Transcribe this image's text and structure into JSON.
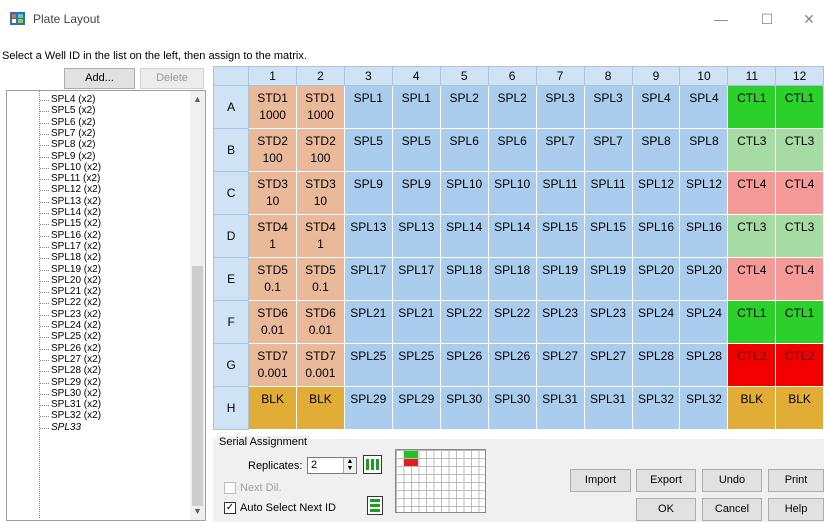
{
  "window": {
    "title": "Plate Layout",
    "minimize": "—",
    "maximize": "☐",
    "close": "✕"
  },
  "instruction": "Select a Well ID in the list on the left, then assign to the matrix.",
  "toolbar": {
    "add": "Add...",
    "delete": "Delete"
  },
  "list_items": [
    "SPL4 (x2)",
    "SPL5 (x2)",
    "SPL6 (x2)",
    "SPL7 (x2)",
    "SPL8 (x2)",
    "SPL9 (x2)",
    "SPL10 (x2)",
    "SPL11 (x2)",
    "SPL12 (x2)",
    "SPL13 (x2)",
    "SPL14 (x2)",
    "SPL15 (x2)",
    "SPL16 (x2)",
    "SPL17 (x2)",
    "SPL18 (x2)",
    "SPL19 (x2)",
    "SPL20 (x2)",
    "SPL21 (x2)",
    "SPL22 (x2)",
    "SPL23 (x2)",
    "SPL24 (x2)",
    "SPL25 (x2)",
    "SPL26 (x2)",
    "SPL27 (x2)",
    "SPL28 (x2)",
    "SPL29 (x2)",
    "SPL30 (x2)",
    "SPL31 (x2)",
    "SPL32 (x2)",
    "SPL33"
  ],
  "grid": {
    "columns": [
      "1",
      "2",
      "3",
      "4",
      "5",
      "6",
      "7",
      "8",
      "9",
      "10",
      "11",
      "12"
    ],
    "rows": [
      {
        "label": "A",
        "cells": [
          [
            "STD1",
            "1000",
            "std"
          ],
          [
            "STD1",
            "1000",
            "std"
          ],
          [
            "SPL1",
            "",
            "spl"
          ],
          [
            "SPL1",
            "",
            "spl"
          ],
          [
            "SPL2",
            "",
            "spl"
          ],
          [
            "SPL2",
            "",
            "spl"
          ],
          [
            "SPL3",
            "",
            "spl"
          ],
          [
            "SPL3",
            "",
            "spl"
          ],
          [
            "SPL4",
            "",
            "spl"
          ],
          [
            "SPL4",
            "",
            "spl"
          ],
          [
            "CTL1",
            "",
            "ctl1"
          ],
          [
            "CTL1",
            "",
            "ctl1"
          ]
        ]
      },
      {
        "label": "B",
        "cells": [
          [
            "STD2",
            "100",
            "std"
          ],
          [
            "STD2",
            "100",
            "std"
          ],
          [
            "SPL5",
            "",
            "spl"
          ],
          [
            "SPL5",
            "",
            "spl"
          ],
          [
            "SPL6",
            "",
            "spl"
          ],
          [
            "SPL6",
            "",
            "spl"
          ],
          [
            "SPL7",
            "",
            "spl"
          ],
          [
            "SPL7",
            "",
            "spl"
          ],
          [
            "SPL8",
            "",
            "spl"
          ],
          [
            "SPL8",
            "",
            "spl"
          ],
          [
            "CTL3",
            "",
            "ctl3"
          ],
          [
            "CTL3",
            "",
            "ctl3"
          ]
        ]
      },
      {
        "label": "C",
        "cells": [
          [
            "STD3",
            "10",
            "std"
          ],
          [
            "STD3",
            "10",
            "std"
          ],
          [
            "SPL9",
            "",
            "spl"
          ],
          [
            "SPL9",
            "",
            "spl"
          ],
          [
            "SPL10",
            "",
            "spl"
          ],
          [
            "SPL10",
            "",
            "spl"
          ],
          [
            "SPL11",
            "",
            "spl"
          ],
          [
            "SPL11",
            "",
            "spl"
          ],
          [
            "SPL12",
            "",
            "spl"
          ],
          [
            "SPL12",
            "",
            "spl"
          ],
          [
            "CTL4",
            "",
            "ctl4"
          ],
          [
            "CTL4",
            "",
            "ctl4"
          ]
        ]
      },
      {
        "label": "D",
        "cells": [
          [
            "STD4",
            "1",
            "std"
          ],
          [
            "STD4",
            "1",
            "std"
          ],
          [
            "SPL13",
            "",
            "spl"
          ],
          [
            "SPL13",
            "",
            "spl"
          ],
          [
            "SPL14",
            "",
            "spl"
          ],
          [
            "SPL14",
            "",
            "spl"
          ],
          [
            "SPL15",
            "",
            "spl"
          ],
          [
            "SPL15",
            "",
            "spl"
          ],
          [
            "SPL16",
            "",
            "spl"
          ],
          [
            "SPL16",
            "",
            "spl"
          ],
          [
            "CTL3",
            "",
            "ctl3"
          ],
          [
            "CTL3",
            "",
            "ctl3"
          ]
        ]
      },
      {
        "label": "E",
        "cells": [
          [
            "STD5",
            "0.1",
            "std"
          ],
          [
            "STD5",
            "0.1",
            "std"
          ],
          [
            "SPL17",
            "",
            "spl"
          ],
          [
            "SPL17",
            "",
            "spl"
          ],
          [
            "SPL18",
            "",
            "spl"
          ],
          [
            "SPL18",
            "",
            "spl"
          ],
          [
            "SPL19",
            "",
            "spl"
          ],
          [
            "SPL19",
            "",
            "spl"
          ],
          [
            "SPL20",
            "",
            "spl"
          ],
          [
            "SPL20",
            "",
            "spl"
          ],
          [
            "CTL4",
            "",
            "ctl4"
          ],
          [
            "CTL4",
            "",
            "ctl4"
          ]
        ]
      },
      {
        "label": "F",
        "cells": [
          [
            "STD6",
            "0.01",
            "std"
          ],
          [
            "STD6",
            "0.01",
            "std"
          ],
          [
            "SPL21",
            "",
            "spl"
          ],
          [
            "SPL21",
            "",
            "spl"
          ],
          [
            "SPL22",
            "",
            "spl"
          ],
          [
            "SPL22",
            "",
            "spl"
          ],
          [
            "SPL23",
            "",
            "spl"
          ],
          [
            "SPL23",
            "",
            "spl"
          ],
          [
            "SPL24",
            "",
            "spl"
          ],
          [
            "SPL24",
            "",
            "spl"
          ],
          [
            "CTL1",
            "",
            "ctl1"
          ],
          [
            "CTL1",
            "",
            "ctl1"
          ]
        ]
      },
      {
        "label": "G",
        "cells": [
          [
            "STD7",
            "0.001",
            "std"
          ],
          [
            "STD7",
            "0.001",
            "std"
          ],
          [
            "SPL25",
            "",
            "spl"
          ],
          [
            "SPL25",
            "",
            "spl"
          ],
          [
            "SPL26",
            "",
            "spl"
          ],
          [
            "SPL26",
            "",
            "spl"
          ],
          [
            "SPL27",
            "",
            "spl"
          ],
          [
            "SPL27",
            "",
            "spl"
          ],
          [
            "SPL28",
            "",
            "spl"
          ],
          [
            "SPL28",
            "",
            "spl"
          ],
          [
            "CTL2",
            "",
            "ctl2"
          ],
          [
            "CTL2",
            "",
            "ctl2"
          ]
        ]
      },
      {
        "label": "H",
        "cells": [
          [
            "BLK",
            "",
            "blk"
          ],
          [
            "BLK",
            "",
            "blk"
          ],
          [
            "SPL29",
            "",
            "spl"
          ],
          [
            "SPL29",
            "",
            "spl"
          ],
          [
            "SPL30",
            "",
            "spl"
          ],
          [
            "SPL30",
            "",
            "spl"
          ],
          [
            "SPL31",
            "",
            "spl"
          ],
          [
            "SPL31",
            "",
            "spl"
          ],
          [
            "SPL32",
            "",
            "spl"
          ],
          [
            "SPL32",
            "",
            "spl"
          ],
          [
            "BLK",
            "",
            "blk"
          ],
          [
            "BLK",
            "",
            "blk"
          ]
        ]
      }
    ]
  },
  "serial": {
    "group_label": "Serial Assignment",
    "replicates_label": "Replicates:",
    "replicates_value": "2",
    "next_dil_label": "Next Dil.",
    "auto_select_label": "Auto Select Next ID"
  },
  "buttons": {
    "import": "Import",
    "export": "Export",
    "undo": "Undo",
    "print": "Print",
    "ok": "OK",
    "cancel": "Cancel",
    "help": "Help"
  },
  "colors": {
    "std": "#eab99a",
    "spl": "#aacdee",
    "ctl1": "#2bd02b",
    "ctl2": "#f20000",
    "ctl3": "#a7dba4",
    "ctl4": "#f69a99",
    "blk": "#e2ad37"
  }
}
